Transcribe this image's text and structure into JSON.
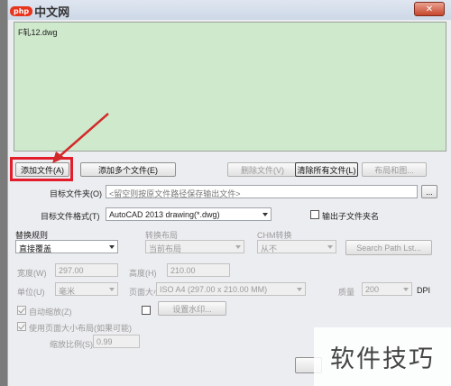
{
  "watermark_top": {
    "badge": "php",
    "text": "中文网"
  },
  "title_bar": {
    "close_glyph": "✕"
  },
  "file_list": {
    "items": [
      "F轧12.dwg"
    ]
  },
  "buttons": {
    "add_file": "添加文件(A)",
    "add_multiple": "添加多个文件(E)",
    "remove_file": "删除文件(V)",
    "clear_all": "清除所有文件(L)",
    "layout": "布局和图...",
    "browse": "..."
  },
  "target_folder": {
    "label": "目标文件夹(O)",
    "placeholder": "<留空则按原文件路径保存输出文件>"
  },
  "target_format": {
    "label": "目标文件格式(T)",
    "value": "AutoCAD 2013 drawing(*.dwg)"
  },
  "output_subfolder": {
    "label": "输出子文件夹名"
  },
  "replace_rule": {
    "label": "替换规则",
    "value": "直接覆盖"
  },
  "layout_section": {
    "label": "转换布局",
    "value": "当前布局"
  },
  "font_section": {
    "label": "CHM转换",
    "value": "从不"
  },
  "search_path_button": "Search Path Lst...",
  "width": {
    "label": "宽度(W)",
    "value": "297.00"
  },
  "height": {
    "label": "高度(H)",
    "value": "210.00"
  },
  "unit": {
    "label": "单位(U)",
    "value": "毫米"
  },
  "page_size": {
    "label": "页面大小",
    "value": "ISO A4 (297.00 x 210.00 MM)"
  },
  "quality": {
    "label": "质量",
    "value": "200",
    "unit": "DPI"
  },
  "auto_zoom": {
    "label": "自动缩放(Z)"
  },
  "watermark_setting": {
    "label": "设置水印..."
  },
  "use_page_layout": {
    "label": "使用页面大小布局(如果可能)"
  },
  "scale": {
    "label": "缩放比例(S)",
    "value": "0.99"
  },
  "bottom_watermark": "软件技巧",
  "annotation": {
    "highlight_color": "#e21d2c"
  }
}
